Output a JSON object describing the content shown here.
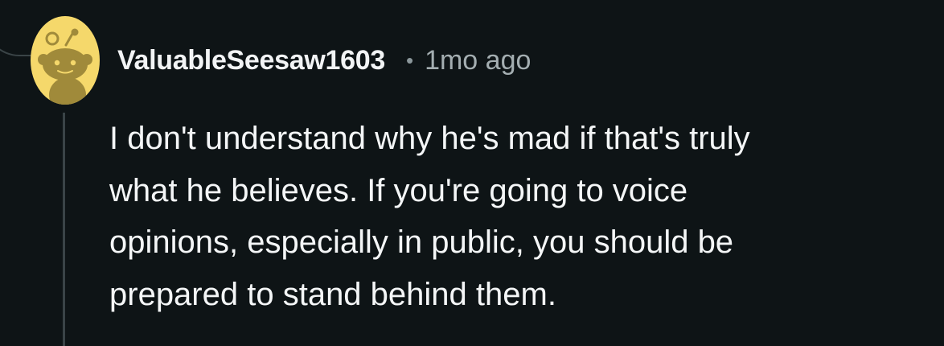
{
  "comment": {
    "author": "ValuableSeesaw1603",
    "separator": "•",
    "timestamp": "1mo ago",
    "avatar_icon": "reddit-snoo-avatar-icon",
    "body_lines": [
      "I don't understand why he's mad if that's truly",
      "what he believes. If you're going to voice",
      "opinions, especially in public, you should be",
      "prepared to stand behind them."
    ]
  },
  "colors": {
    "background": "#0e1416",
    "avatar_bg": "#f5d86b",
    "avatar_figure": "#a08a3a",
    "thread_line": "#3a4447",
    "text": "#f2f4f5",
    "meta_text": "#a4aeb1"
  }
}
